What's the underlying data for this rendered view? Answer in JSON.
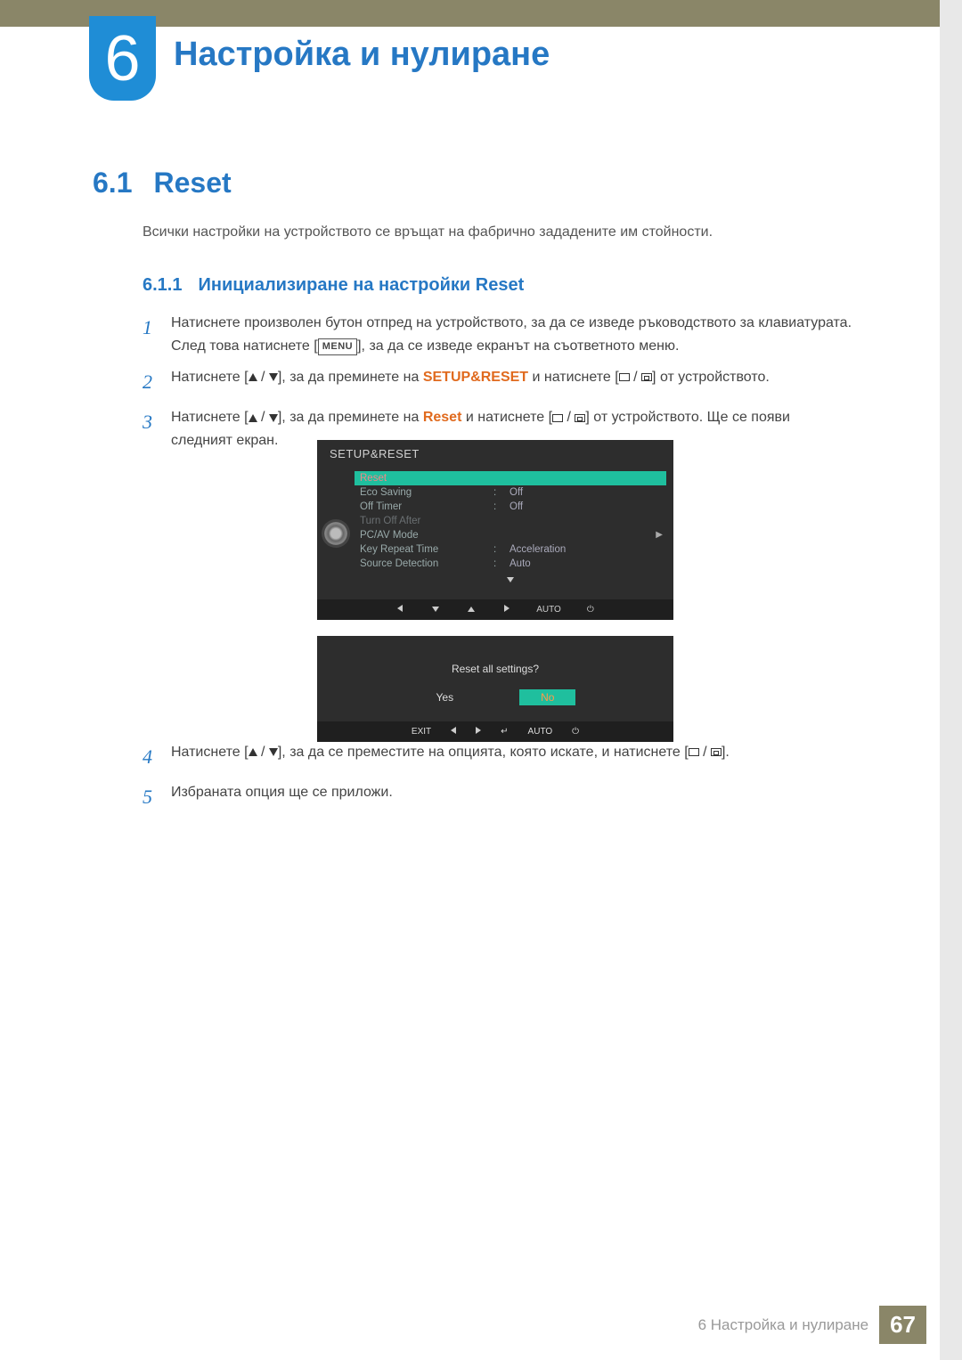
{
  "chapter": {
    "number": "6",
    "title": "Настройка и нулиране"
  },
  "section": {
    "number": "6.1",
    "title": "Reset"
  },
  "intro": "Всички настройки на устройството се връщат на фабрично зададените им стойности.",
  "subsection": {
    "number": "6.1.1",
    "title": "Инициализиране на настройки Reset"
  },
  "steps": {
    "s1a": "Натиснете произволен бутон отпред на устройството, за да се изведе ръководството за клавиатурата. След това натиснете [",
    "s1b": "], за да се изведе екранът на съответното меню.",
    "menu_label": "MENU",
    "s2a": "Натиснете [",
    "s2b": "], за да преминете на ",
    "s2_hl": "SETUP&RESET",
    "s2c": " и натиснете [",
    "s2d": "] от устройството.",
    "s3a": "Натиснете [",
    "s3b": "], за да преминете на ",
    "s3_hl": "Reset",
    "s3c": " и натиснете [",
    "s3d": "] от устройството. Ще се появи следният екран.",
    "s4a": "Натиснете [",
    "s4b": "], за да се преместите на опцията, която искате, и натиснете [",
    "s4c": "].",
    "s5": "Избраната опция ще се приложи."
  },
  "osd1": {
    "title": "SETUP&RESET",
    "rows": [
      {
        "label": "Reset",
        "val": "",
        "sel": true
      },
      {
        "label": "Eco Saving",
        "val": "Off"
      },
      {
        "label": "Off Timer",
        "val": "Off"
      },
      {
        "label": "Turn Off After",
        "val": "",
        "dim": true
      },
      {
        "label": "PC/AV Mode",
        "val": "",
        "arrow": true
      },
      {
        "label": "Key Repeat Time",
        "val": "Acceleration"
      },
      {
        "label": "Source Detection",
        "val": "Auto"
      }
    ],
    "footer_auto": "AUTO"
  },
  "osd2": {
    "question": "Reset all settings?",
    "yes": "Yes",
    "no": "No",
    "exit": "EXIT",
    "auto": "AUTO"
  },
  "footer": {
    "text": "6 Настройка и нулиране",
    "page": "67"
  }
}
